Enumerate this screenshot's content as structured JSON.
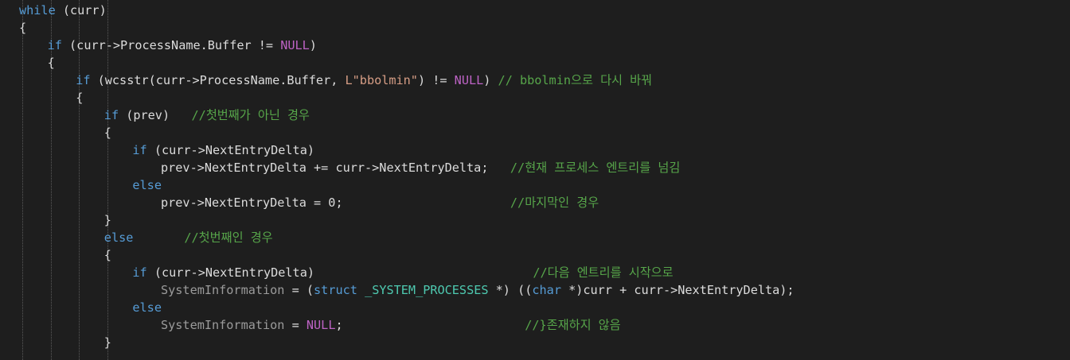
{
  "editor": {
    "lines": [
      {
        "indent": 0,
        "tokens": [
          {
            "c": "kw",
            "t": "while"
          },
          {
            "c": "",
            "t": " (curr)"
          }
        ]
      },
      {
        "indent": 0,
        "tokens": [
          {
            "c": "",
            "t": "{"
          }
        ]
      },
      {
        "indent": 1,
        "tokens": [
          {
            "c": "kw",
            "t": "if"
          },
          {
            "c": "",
            "t": " (curr->ProcessName.Buffer != "
          },
          {
            "c": "mac",
            "t": "NULL"
          },
          {
            "c": "",
            "t": ")"
          }
        ]
      },
      {
        "indent": 1,
        "tokens": [
          {
            "c": "",
            "t": "{"
          }
        ]
      },
      {
        "indent": 2,
        "tokens": [
          {
            "c": "kw",
            "t": "if"
          },
          {
            "c": "",
            "t": " (wcsstr(curr->ProcessName.Buffer, "
          },
          {
            "c": "str",
            "t": "L\"bbolmin\""
          },
          {
            "c": "",
            "t": ") != "
          },
          {
            "c": "mac",
            "t": "NULL"
          },
          {
            "c": "",
            "t": ") "
          },
          {
            "c": "cmt",
            "t": "// bbolmin으로 다시 바꿔"
          }
        ]
      },
      {
        "indent": 2,
        "tokens": [
          {
            "c": "",
            "t": "{"
          }
        ]
      },
      {
        "indent": 3,
        "tokens": [
          {
            "c": "kw",
            "t": "if"
          },
          {
            "c": "",
            "t": " (prev)   "
          },
          {
            "c": "cmt",
            "t": "//첫번째가 아닌 경우"
          }
        ]
      },
      {
        "indent": 3,
        "tokens": [
          {
            "c": "",
            "t": "{"
          }
        ]
      },
      {
        "indent": 4,
        "tokens": [
          {
            "c": "kw",
            "t": "if"
          },
          {
            "c": "",
            "t": " (curr->NextEntryDelta)"
          }
        ]
      },
      {
        "indent": 5,
        "tokens": [
          {
            "c": "",
            "t": "prev->NextEntryDelta += curr->NextEntryDelta;   "
          },
          {
            "c": "cmt",
            "t": "//현재 프로세스 엔트리를 넘김"
          }
        ]
      },
      {
        "indent": 4,
        "tokens": [
          {
            "c": "kw",
            "t": "else"
          }
        ]
      },
      {
        "indent": 5,
        "tokens": [
          {
            "c": "",
            "t": "prev->NextEntryDelta = 0;                       "
          },
          {
            "c": "cmt",
            "t": "//마지막인 경우"
          }
        ]
      },
      {
        "indent": 3,
        "tokens": [
          {
            "c": "",
            "t": "}"
          }
        ]
      },
      {
        "indent": 3,
        "tokens": [
          {
            "c": "kw",
            "t": "else"
          },
          {
            "c": "",
            "t": "       "
          },
          {
            "c": "cmt",
            "t": "//첫번째인 경우"
          }
        ]
      },
      {
        "indent": 3,
        "tokens": [
          {
            "c": "",
            "t": "{"
          }
        ]
      },
      {
        "indent": 4,
        "tokens": [
          {
            "c": "kw",
            "t": "if"
          },
          {
            "c": "",
            "t": " (curr->NextEntryDelta)                              "
          },
          {
            "c": "cmt",
            "t": "//다음 엔트리를 시작으로"
          }
        ]
      },
      {
        "indent": 5,
        "tokens": [
          {
            "c": "gray",
            "t": "SystemInformation"
          },
          {
            "c": "",
            "t": " = ("
          },
          {
            "c": "kw",
            "t": "struct"
          },
          {
            "c": "",
            "t": " "
          },
          {
            "c": "ty",
            "t": "_SYSTEM_PROCESSES"
          },
          {
            "c": "",
            "t": " *) (("
          },
          {
            "c": "kw",
            "t": "char"
          },
          {
            "c": "",
            "t": " *)curr + curr->NextEntryDelta);"
          }
        ]
      },
      {
        "indent": 4,
        "tokens": [
          {
            "c": "kw",
            "t": "else"
          }
        ]
      },
      {
        "indent": 5,
        "tokens": [
          {
            "c": "gray",
            "t": "SystemInformation"
          },
          {
            "c": "",
            "t": " = "
          },
          {
            "c": "mac",
            "t": "NULL"
          },
          {
            "c": "",
            "t": ";                         "
          },
          {
            "c": "cmt",
            "t": "//}존재하지 않음"
          }
        ]
      },
      {
        "indent": 3,
        "tokens": [
          {
            "c": "",
            "t": "}"
          }
        ]
      }
    ]
  }
}
